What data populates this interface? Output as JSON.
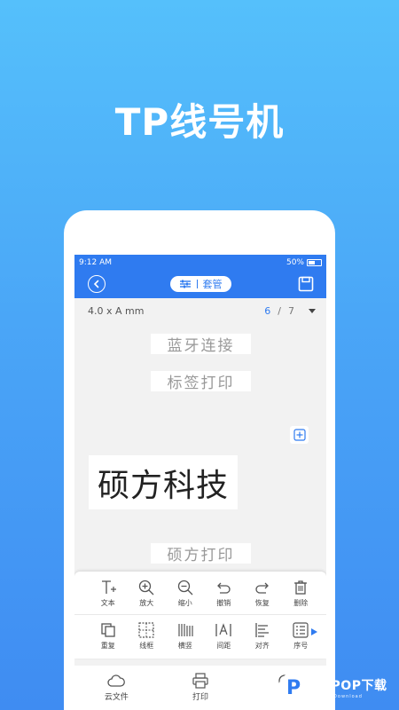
{
  "headline": "TP线号机",
  "status_bar": {
    "time": "9:12 AM",
    "battery": "50%"
  },
  "nav": {
    "pill_label": "套管"
  },
  "size_bar": {
    "label_size": "4.0 x A mm",
    "current_page": "6",
    "separator": "/",
    "total_pages": "7"
  },
  "canvas": {
    "texts": [
      {
        "text": "蓝牙连接",
        "style": "faded"
      },
      {
        "text": "标签打印",
        "style": "faded"
      },
      {
        "text": "硕方科技",
        "style": "large"
      },
      {
        "text": "硕方打印",
        "style": "faded"
      }
    ]
  },
  "tools": {
    "row1": [
      {
        "label": "文本",
        "icon": "text-add-icon"
      },
      {
        "label": "放大",
        "icon": "zoom-in-icon"
      },
      {
        "label": "缩小",
        "icon": "zoom-out-icon"
      },
      {
        "label": "撤销",
        "icon": "undo-icon"
      },
      {
        "label": "恢复",
        "icon": "redo-icon"
      },
      {
        "label": "删除",
        "icon": "trash-icon"
      }
    ],
    "row2": [
      {
        "label": "重复",
        "icon": "copy-icon"
      },
      {
        "label": "线框",
        "icon": "frame-icon"
      },
      {
        "label": "横竖",
        "icon": "orientation-icon"
      },
      {
        "label": "间距",
        "icon": "spacing-icon"
      },
      {
        "label": "对齐",
        "icon": "align-icon"
      },
      {
        "label": "序号",
        "icon": "list-number-icon"
      }
    ]
  },
  "tabs": [
    {
      "label": "云文件",
      "icon": "cloud-icon"
    },
    {
      "label": "打印",
      "icon": "printer-icon"
    },
    {
      "label": "",
      "icon": "settings-icon"
    }
  ],
  "watermark": {
    "brand": "PCPOP下载",
    "sub": "PCPOP Download"
  },
  "colors": {
    "accent": "#2f7bf0",
    "background_top": "#55c0fb",
    "background_bottom": "#3f8cf2"
  }
}
